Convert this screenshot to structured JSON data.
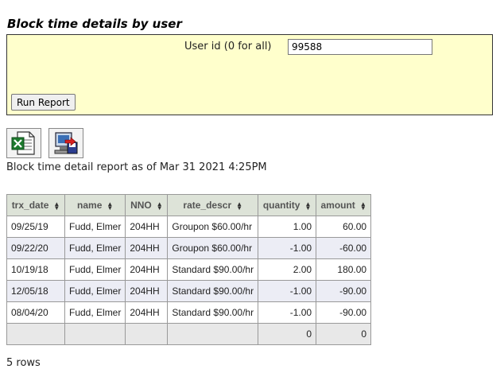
{
  "page_title": "Block time details by user",
  "form": {
    "user_id_label": "User id (0 for all)",
    "user_id_value": "99588",
    "run_button_label": "Run Report"
  },
  "export_icons": [
    "excel-export-icon",
    "save-report-icon"
  ],
  "report": {
    "asof_prefix": "Block time detail report as of",
    "asof_timestamp": "Mar 31 2021 4:25PM"
  },
  "table": {
    "columns": [
      "trx_date",
      "name",
      "NNO",
      "rate_descr",
      "quantity",
      "amount"
    ],
    "rows": [
      [
        "09/25/19",
        "Fudd, Elmer",
        "204HH",
        "Groupon $60.00/hr",
        "1.00",
        "60.00"
      ],
      [
        "09/22/20",
        "Fudd, Elmer",
        "204HH",
        "Groupon $60.00/hr",
        "-1.00",
        "-60.00"
      ],
      [
        "10/19/18",
        "Fudd, Elmer",
        "204HH",
        "Standard $90.00/hr",
        "2.00",
        "180.00"
      ],
      [
        "12/05/18",
        "Fudd, Elmer",
        "204HH",
        "Standard $90.00/hr",
        "-1.00",
        "-90.00"
      ],
      [
        "08/04/20",
        "Fudd, Elmer",
        "204HH",
        "Standard $90.00/hr",
        "-1.00",
        "-90.00"
      ]
    ],
    "totals": {
      "quantity": "0",
      "amount": "0"
    }
  },
  "row_count_text": "5 rows"
}
